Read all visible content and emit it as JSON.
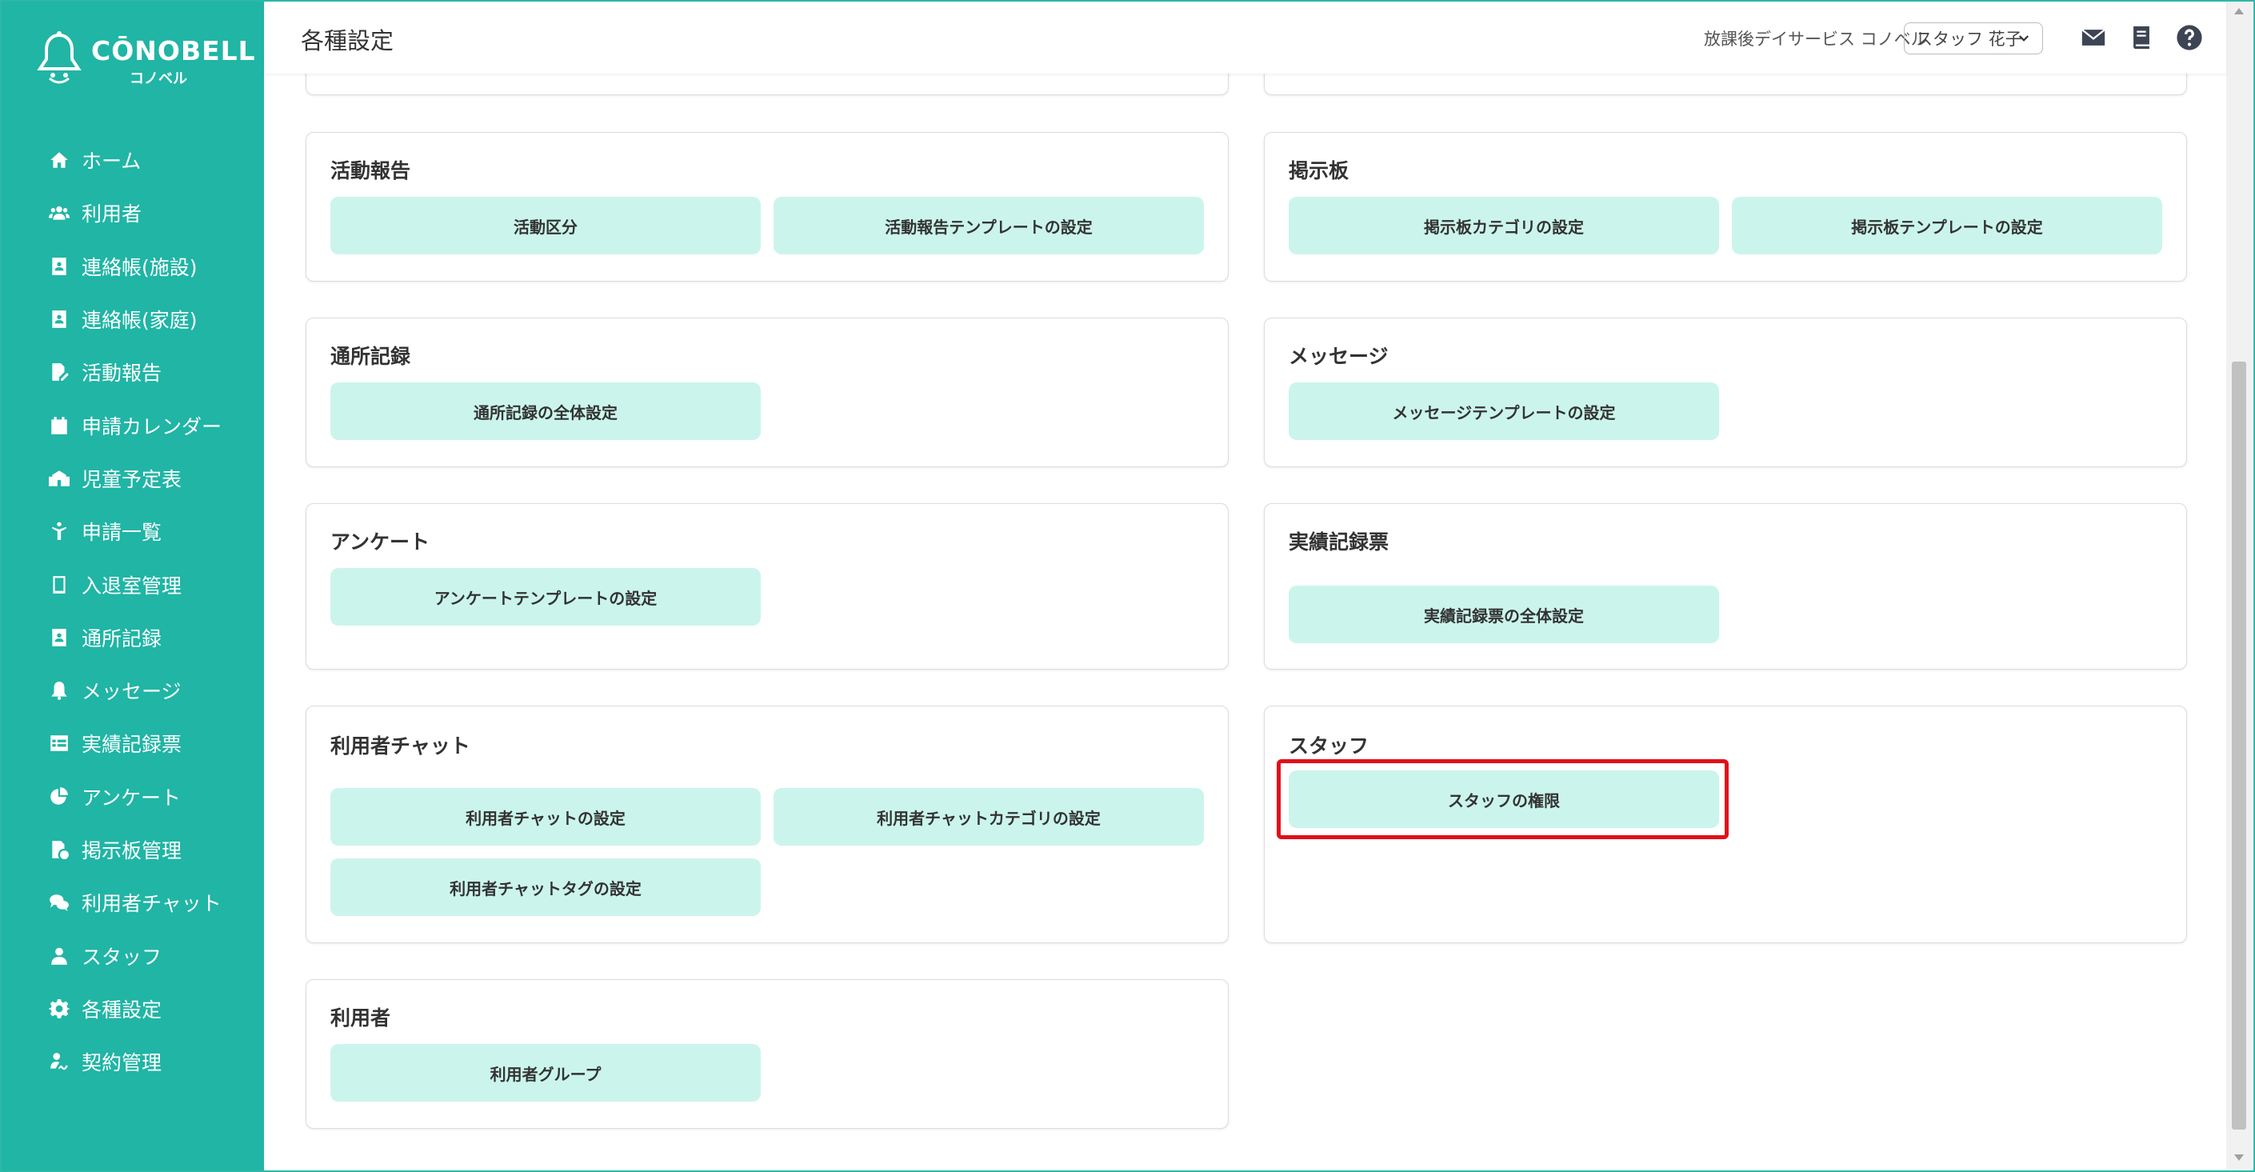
{
  "app": {
    "logo_text": "CŌNOBELL",
    "logo_sub": "コノベル"
  },
  "sidebar": {
    "items": [
      {
        "label": "ホーム",
        "icon": "home-icon"
      },
      {
        "label": "利用者",
        "icon": "users-icon"
      },
      {
        "label": "連絡帳(施設)",
        "icon": "contact-book-icon"
      },
      {
        "label": "連絡帳(家庭)",
        "icon": "contact-book-icon"
      },
      {
        "label": "活動報告",
        "icon": "report-edit-icon"
      },
      {
        "label": "申請カレンダー",
        "icon": "calendar-icon"
      },
      {
        "label": "児童予定表",
        "icon": "school-icon"
      },
      {
        "label": "申請一覧",
        "icon": "child-icon"
      },
      {
        "label": "入退室管理",
        "icon": "tablet-icon"
      },
      {
        "label": "通所記録",
        "icon": "contact-book-icon"
      },
      {
        "label": "メッセージ",
        "icon": "bell-icon"
      },
      {
        "label": "実績記録票",
        "icon": "table-icon"
      },
      {
        "label": "アンケート",
        "icon": "pie-chart-icon"
      },
      {
        "label": "掲示板管理",
        "icon": "file-clock-icon"
      },
      {
        "label": "利用者チャット",
        "icon": "chat-icon"
      },
      {
        "label": "スタッフ",
        "icon": "staff-icon"
      },
      {
        "label": "各種設定",
        "icon": "gear-icon"
      },
      {
        "label": "契約管理",
        "icon": "signature-icon"
      }
    ]
  },
  "header": {
    "title": "各種設定",
    "facility": "放課後デイサービス コノベル",
    "staff_name": "スタッフ 花子",
    "icons": [
      "mail-icon",
      "book-icon",
      "help-icon"
    ]
  },
  "sections": {
    "activity": {
      "title": "活動報告",
      "buttons": [
        "活動区分",
        "活動報告テンプレートの設定"
      ]
    },
    "board": {
      "title": "掲示板",
      "buttons": [
        "掲示板カテゴリの設定",
        "掲示板テンプレートの設定"
      ]
    },
    "attendance": {
      "title": "通所記録",
      "buttons": [
        "通所記録の全体設定"
      ]
    },
    "message": {
      "title": "メッセージ",
      "buttons": [
        "メッセージテンプレートの設定"
      ]
    },
    "survey": {
      "title": "アンケート",
      "buttons": [
        "アンケートテンプレートの設定"
      ]
    },
    "records": {
      "title": "実績記録票",
      "buttons": [
        "実績記録票の全体設定"
      ]
    },
    "chat": {
      "title": "利用者チャット",
      "buttons": [
        "利用者チャットの設定",
        "利用者チャットカテゴリの設定",
        "利用者チャットタグの設定"
      ]
    },
    "staff": {
      "title": "スタッフ",
      "buttons": [
        "スタッフの権限"
      ]
    },
    "users": {
      "title": "利用者",
      "buttons": [
        "利用者グループ"
      ]
    }
  },
  "colors": {
    "sidebar": "#20b5a5",
    "button": "#cbf5ec",
    "highlight": "#e0101a"
  }
}
